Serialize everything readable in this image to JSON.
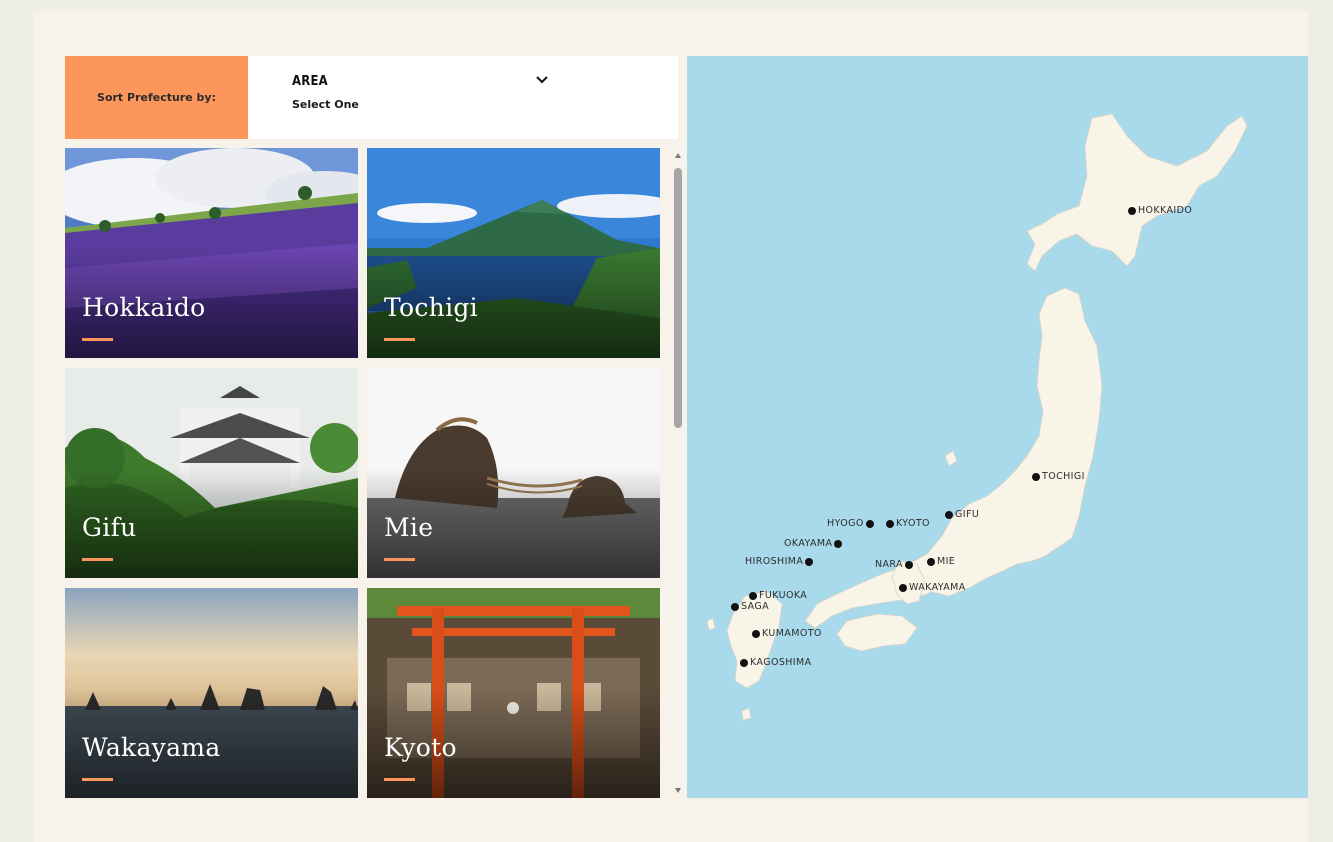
{
  "sort": {
    "label": "Sort Prefecture by:",
    "field_title": "AREA",
    "selected": "Select One",
    "icon": "chevron-down-icon"
  },
  "colors": {
    "accent": "#fd965b",
    "map_water": "#a8daec",
    "map_land": "#f9f4e8",
    "frame_bg": "#f7f3ea"
  },
  "cards": [
    {
      "name": "Hokkaido"
    },
    {
      "name": "Tochigi"
    },
    {
      "name": "Gifu"
    },
    {
      "name": "Mie"
    },
    {
      "name": "Wakayama"
    },
    {
      "name": "Kyoto"
    }
  ],
  "map": {
    "pins": [
      {
        "label": "HOKKAIDO"
      },
      {
        "label": "TOCHIGI"
      },
      {
        "label": "GIFU"
      },
      {
        "label": "HYOGO"
      },
      {
        "label": "KYOTO"
      },
      {
        "label": "OKAYAMA"
      },
      {
        "label": "HIROSHIMA"
      },
      {
        "label": "NARA"
      },
      {
        "label": "MIE"
      },
      {
        "label": "WAKAYAMA"
      },
      {
        "label": "FUKUOKA"
      },
      {
        "label": "SAGA"
      },
      {
        "label": "KUMAMOTO"
      },
      {
        "label": "KAGOSHIMA"
      }
    ]
  }
}
